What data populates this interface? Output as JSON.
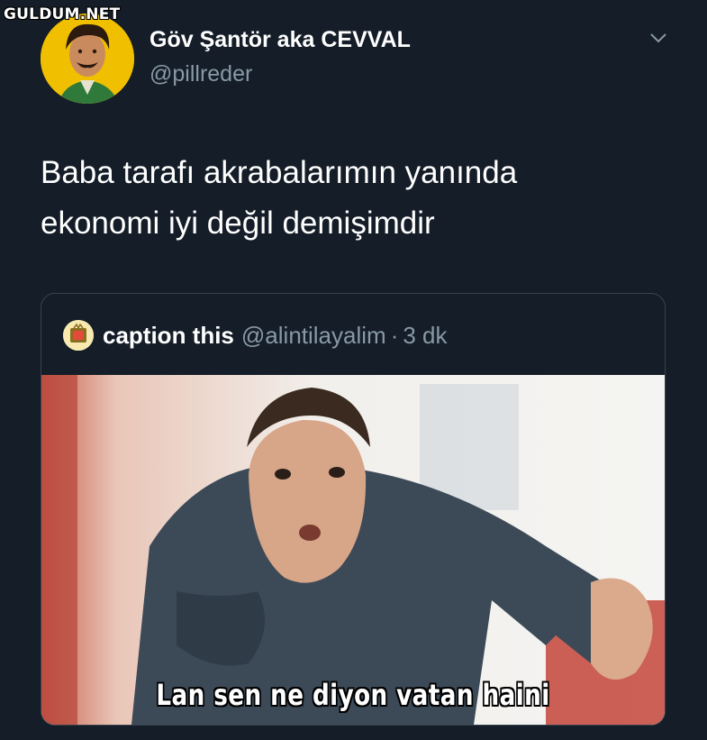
{
  "watermark": "GULDUM.NET",
  "tweet": {
    "author": {
      "display_name": "Göv Şantör aka CEVVAL",
      "handle": "@pillreder",
      "avatar_icon": "profile-photo"
    },
    "menu_icon": "chevron-down-icon",
    "text_lines": [
      "Baba tarafı akrabalarımın yanında",
      "ekonomi iyi değil demişimdir"
    ]
  },
  "quote": {
    "author": {
      "display_name": "caption this",
      "handle": "@alintilayalim",
      "separator": "·",
      "time": "3 dk"
    },
    "media": {
      "caption": "Lan sen ne diyon vatan haini"
    }
  },
  "colors": {
    "background": "#141d28",
    "secondary_text": "#8899a6",
    "border": "#38444d"
  }
}
